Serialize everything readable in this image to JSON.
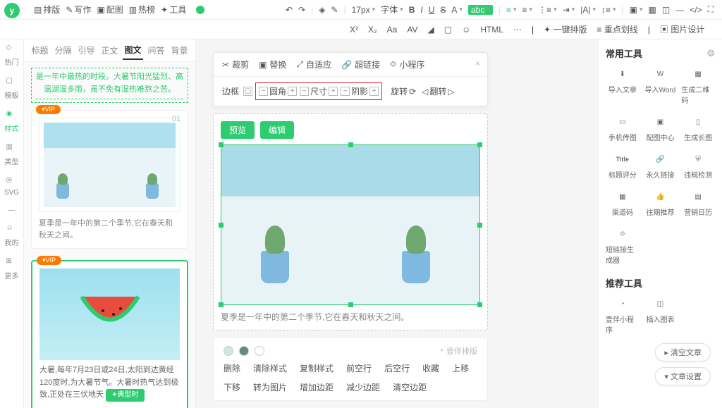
{
  "topNav": {
    "logo": "y",
    "items": [
      "排版",
      "写作",
      "配图",
      "热榜",
      "工具"
    ]
  },
  "toolbar1": {
    "fontSize": "17px",
    "fontFamily": "字体",
    "bold": "B",
    "italic": "I",
    "underline": "U",
    "strike": "S",
    "letterA": "A",
    "abcBadge": "abc"
  },
  "toolbar2": {
    "sup": "X²",
    "sub": "X₂",
    "oneClick": "一键排版",
    "highlight": "重点划线",
    "picDesign": "图片设计"
  },
  "leftRail": [
    "热门",
    "模板",
    "样式",
    "类型",
    "SVG",
    "—",
    "我的",
    "更多"
  ],
  "tabs": [
    "标题",
    "分隔",
    "引导",
    "正文",
    "图文",
    "问答",
    "背景"
  ],
  "intro": {
    "line1": "是一年中最热的时段。大暑节阳光猛烈、高",
    "line2": "温湖湿多雨，虽不免有湿热难熬之苦。"
  },
  "card1": {
    "vip": "▾VIP",
    "num": "01",
    "caption": "夏季是一年中的第二个季节,它在春天和秋天之间。"
  },
  "card2": {
    "vip": "▾VIP",
    "text": "大暑,每年7月23日或24日,太阳到达黄经120度时,为大暑节气。大暑时热气达到极致,正处在三伏地天",
    "pill": "✦典型时"
  },
  "floatPanel": {
    "row1": [
      "裁剪",
      "替换",
      "自适应",
      "超链接",
      "小程序"
    ],
    "close": "×",
    "row2": {
      "frame": "边框",
      "chips": [
        "圆角",
        "尺寸",
        "阴影"
      ],
      "rotate": "旋转",
      "flip": "翻转"
    }
  },
  "imgBlock": {
    "btns": [
      "预览",
      "编辑"
    ],
    "caption": "夏季是一年中的第二个季节,它在春天和秋天之间。"
  },
  "ctxPanel": {
    "brand": "壹伴排版",
    "actions": [
      "删除",
      "清除样式",
      "复制样式",
      "前空行",
      "后空行",
      "收藏",
      "上移",
      "下移",
      "转为图片",
      "增加边距",
      "减少边距",
      "清空边距"
    ]
  },
  "rightBar": {
    "title1": "常用工具",
    "tools": [
      "导入文章",
      "导入Word",
      "生成二维码",
      "手机传图",
      "配图中心",
      "生成长图",
      "标题评分",
      "永久链接",
      "违规检测",
      "渠道码",
      "往期推荐",
      "营销日历",
      "短链接生成器"
    ],
    "title2": "推荐工具",
    "rec": [
      "壹伴小程序",
      "插入图表"
    ]
  },
  "pillBtns": [
    "清空文章",
    "文章设置"
  ]
}
